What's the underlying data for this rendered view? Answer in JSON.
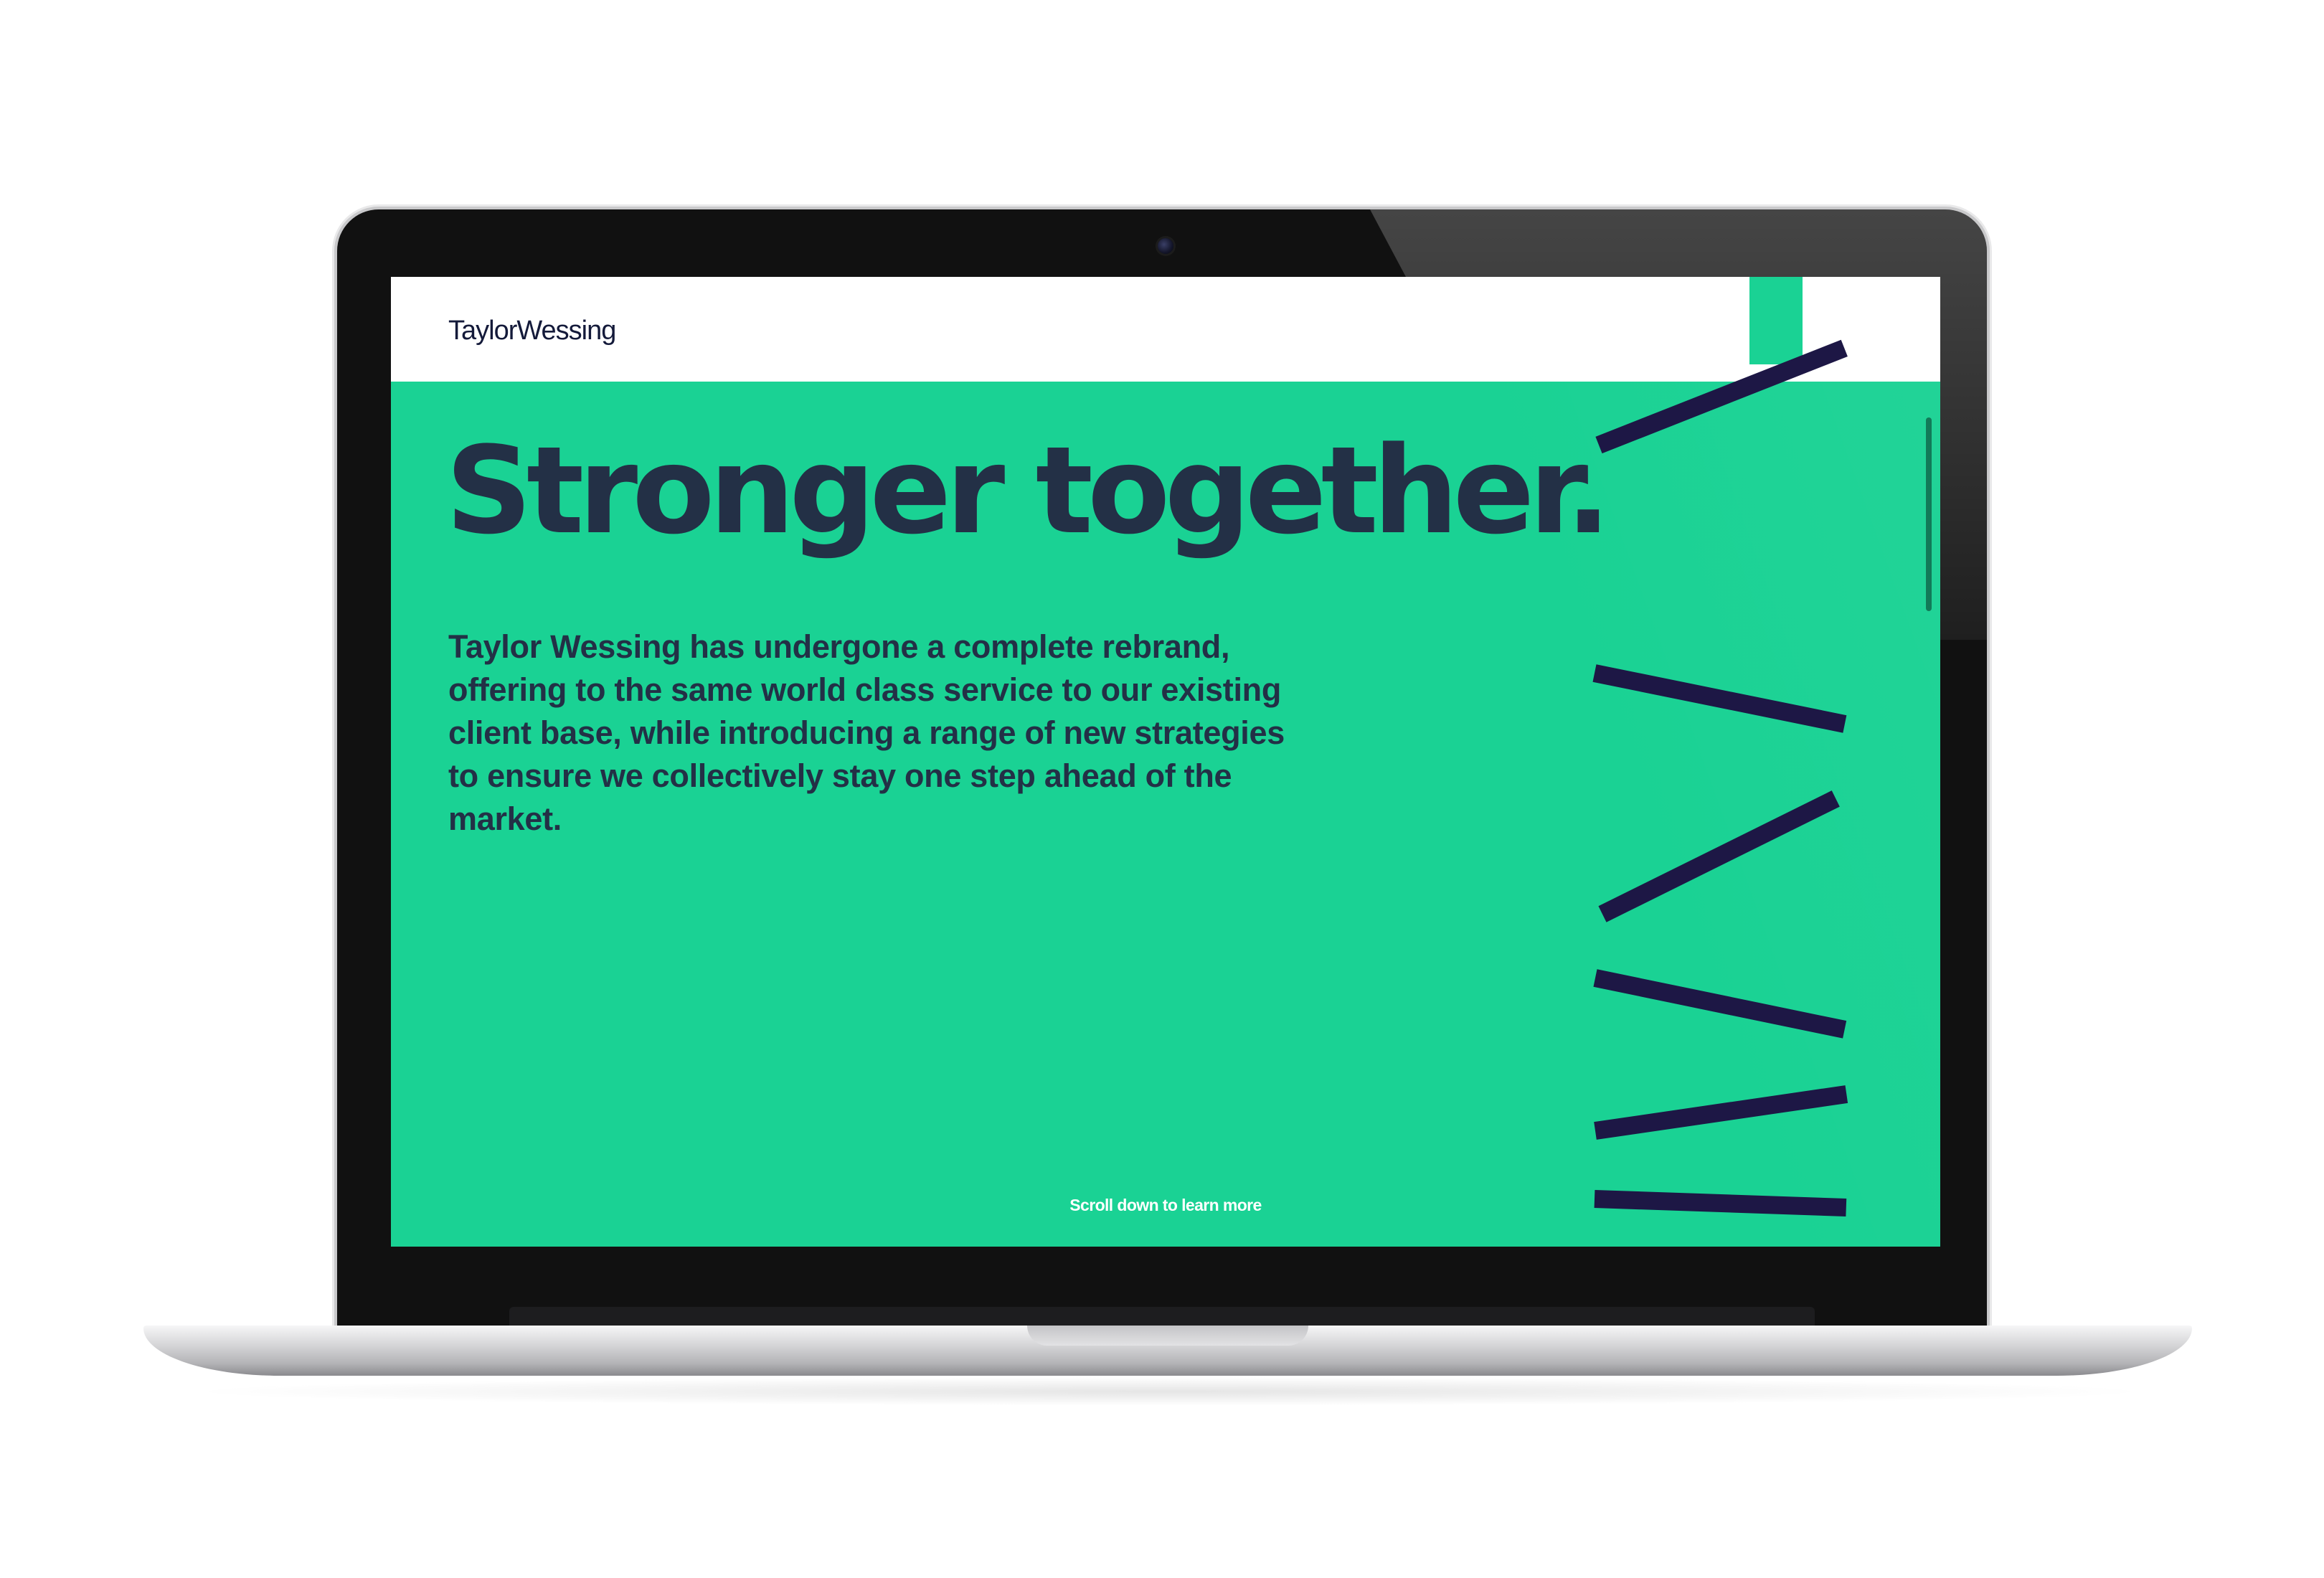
{
  "site": {
    "logo_text": "TaylorWessing",
    "headline": "Stronger together.",
    "intro": "Taylor Wessing has undergone a complete rebrand, offering to the same world class service to our existing client base, while introducing a range of new strategies to ensure we collectively stay one step ahead of the market.",
    "scroll_hint": "Scroll down to learn more"
  },
  "colors": {
    "brand_green": "#1ad294",
    "text_navy": "#233046",
    "stripe_navy": "#1d1745",
    "logo_navy": "#141a3a"
  },
  "icons": {
    "menu": "menu-tab",
    "camera": "camera-icon"
  }
}
